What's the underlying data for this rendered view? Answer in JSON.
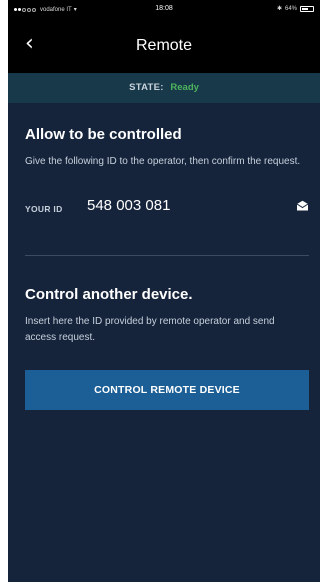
{
  "status_bar": {
    "carrier": "vodafone IT",
    "time": "18:08",
    "battery": "64%",
    "battery_level": 0.64
  },
  "nav": {
    "back_icon": "chevron-left-icon",
    "title": "Remote"
  },
  "state": {
    "label": "STATE:",
    "value": "Ready",
    "value_color": "#4db35c"
  },
  "allow_section": {
    "heading": "Allow to be controlled",
    "description": "Give the following ID to the operator, then confirm the request.",
    "id_label": "YOUR ID",
    "id_value": "548 003 081",
    "share_icon": "envelope-icon"
  },
  "control_section": {
    "heading": "Control another device.",
    "description": "Insert here the ID provided by remote operator and send access request.",
    "button_label": "CONTROL REMOTE DEVICE"
  },
  "colors": {
    "background": "#15243b",
    "state_bar": "#18394a",
    "button": "#1c5f96"
  }
}
